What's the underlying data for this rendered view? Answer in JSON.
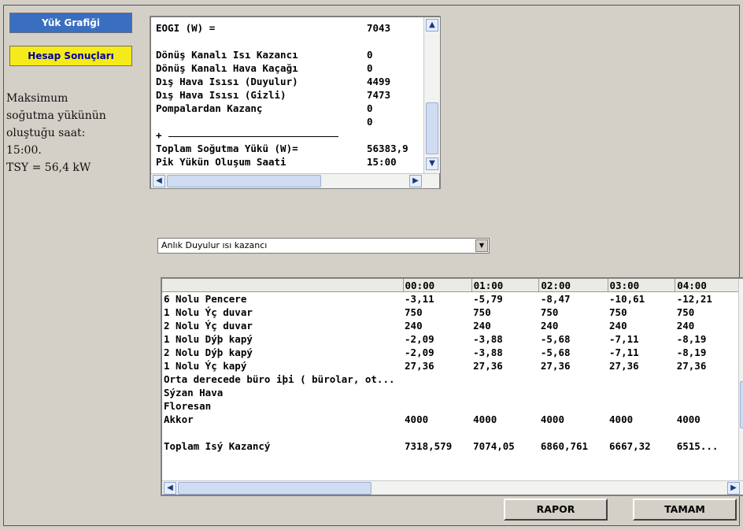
{
  "sidebar": {
    "graph_button": "Yük Grafiği",
    "results_button": "Hesap Sonuçları",
    "note_lines": [
      "Maksimum",
      "soğutma yükünün",
      "oluştuğu saat:",
      "15:00.",
      "TSY = 56,4 kW"
    ]
  },
  "summary": {
    "rows": [
      {
        "label": "EOGI (W) =",
        "value": "7043"
      },
      {
        "label": "",
        "value": ""
      },
      {
        "label": "Dönüş Kanalı Isı Kazancı",
        "value": "0"
      },
      {
        "label": "Dönüş Kanalı Hava Kaçağı",
        "value": "0"
      },
      {
        "label": "Dış Hava Isısı (Duyulur)",
        "value": "4499"
      },
      {
        "label": "Dış Hava Isısı (Gizli)",
        "value": "7473"
      },
      {
        "label": "Pompalardan Kazanç",
        "value": "0"
      },
      {
        "label": "",
        "value": "0"
      },
      {
        "label": "+",
        "value": ""
      },
      {
        "label": "Toplam Soğutma Yükü (W)=",
        "value": "56383,9"
      },
      {
        "label": "Pik Yükün Oluşum Saati",
        "value": "15:00"
      }
    ]
  },
  "dropdown": {
    "selected": "Anlık Duyulur ısı kazancı"
  },
  "table": {
    "headers": [
      "",
      "00:00",
      "01:00",
      "02:00",
      "03:00",
      "04:00"
    ],
    "rows": [
      [
        "6 Nolu Pencere",
        "-3,11",
        "-5,79",
        "-8,47",
        "-10,61",
        "-12,21"
      ],
      [
        "1 Nolu Ýç duvar",
        "750",
        "750",
        "750",
        "750",
        "750"
      ],
      [
        "2 Nolu Ýç duvar",
        "240",
        "240",
        "240",
        "240",
        "240"
      ],
      [
        "1 Nolu Dýþ kapý",
        "-2,09",
        "-3,88",
        "-5,68",
        "-7,11",
        "-8,19"
      ],
      [
        "2 Nolu Dýþ kapý",
        "-2,09",
        "-3,88",
        "-5,68",
        "-7,11",
        "-8,19"
      ],
      [
        "1 Nolu Ýç kapý",
        "27,36",
        "27,36",
        "27,36",
        "27,36",
        "27,36"
      ],
      [
        "Orta derecede büro iþi ( bürolar, ot...",
        "",
        "",
        "",
        "",
        ""
      ],
      [
        "Sýzan Hava",
        "",
        "",
        "",
        "",
        ""
      ],
      [
        "Floresan",
        "",
        "",
        "",
        "",
        ""
      ],
      [
        "Akkor",
        "4000",
        "4000",
        "4000",
        "4000",
        "4000"
      ],
      [
        "",
        "",
        "",
        "",
        "",
        ""
      ],
      [
        "Toplam Isý Kazancý",
        "7318,579",
        "7074,05",
        "6860,761",
        "6667,32",
        "6515..."
      ]
    ]
  },
  "buttons": {
    "report": "RAPOR",
    "ok": "TAMAM"
  },
  "icons": {
    "up": "scroll-up-icon",
    "down": "scroll-down-icon",
    "left": "scroll-left-icon",
    "right": "scroll-right-icon",
    "dropdown": "chevron-down-icon"
  }
}
